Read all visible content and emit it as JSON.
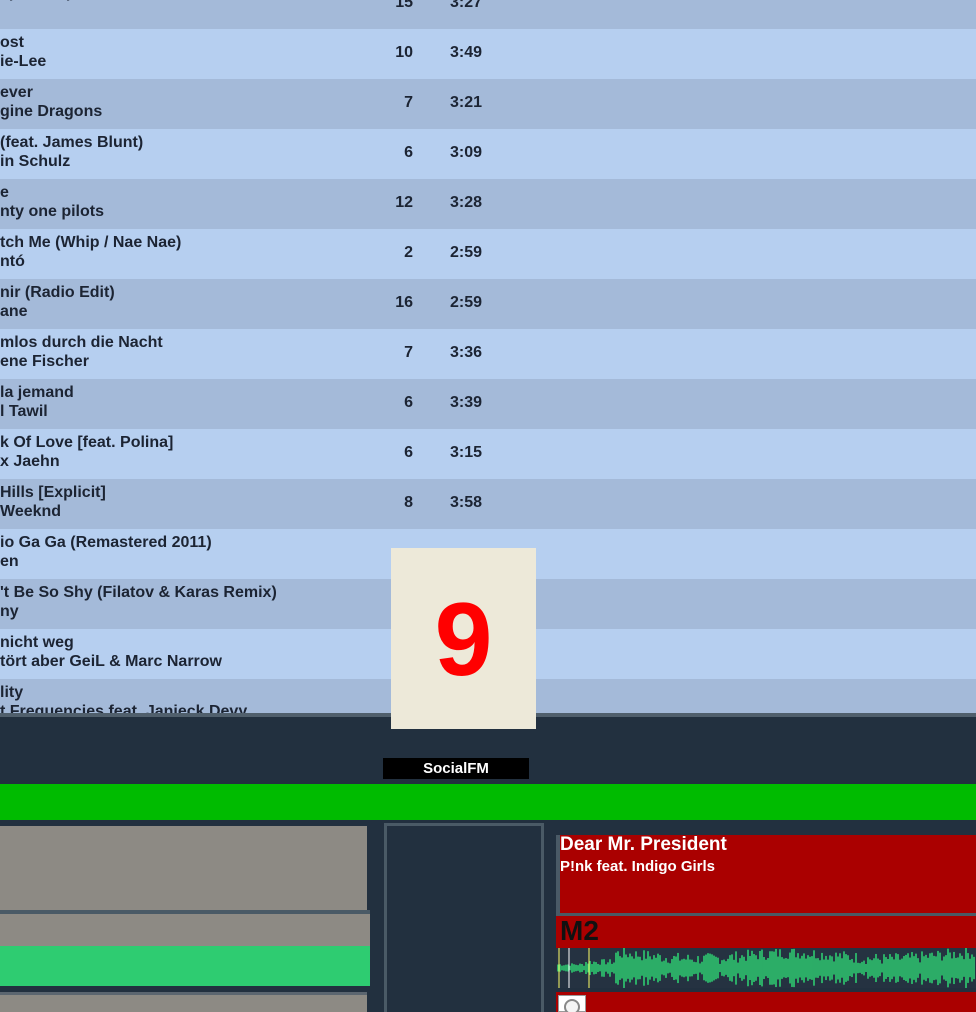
{
  "playlist": {
    "rows": [
      {
        "line1": "sperlenspiel",
        "line2": "",
        "num": "15",
        "dur": "3:27"
      },
      {
        "line1": "ost",
        "line2": "ie-Lee",
        "num": "10",
        "dur": "3:49"
      },
      {
        "line1": "ever",
        "line2": "gine Dragons",
        "num": "7",
        "dur": "3:21"
      },
      {
        "line1": "(feat. James Blunt)",
        "line2": "in Schulz",
        "num": "6",
        "dur": "3:09"
      },
      {
        "line1": "e",
        "line2": "nty one pilots",
        "num": "12",
        "dur": "3:28"
      },
      {
        "line1": "tch Me (Whip / Nae Nae)",
        "line2": "ntó",
        "num": "2",
        "dur": "2:59"
      },
      {
        "line1": "nir (Radio Edit)",
        "line2": "ane",
        "num": "16",
        "dur": "2:59"
      },
      {
        "line1": "mlos durch die Nacht",
        "line2": "ene Fischer",
        "num": "7",
        "dur": "3:36"
      },
      {
        "line1": "la jemand",
        "line2": "l Tawil",
        "num": "6",
        "dur": "3:39"
      },
      {
        "line1": "k Of Love [feat. Polina]",
        "line2": "x Jaehn",
        "num": "6",
        "dur": "3:15"
      },
      {
        "line1": " Hills [Explicit]",
        "line2": " Weeknd",
        "num": "8",
        "dur": "3:58"
      },
      {
        "line1": "io Ga Ga (Remastered 2011)",
        "line2": "en",
        "num": "",
        "dur": ""
      },
      {
        "line1": "'t Be So Shy (Filatov & Karas Remix)",
        "line2": "ny",
        "num": "",
        "dur": ""
      },
      {
        "line1": " nicht weg",
        "line2": "tört aber GeiL & Marc Narrow",
        "num": "",
        "dur": ""
      },
      {
        "line1": "lity",
        "line2": "t Frequencies feat. Janieck Devy",
        "num": "",
        "dur": ""
      }
    ]
  },
  "counter": {
    "value": "9"
  },
  "station": {
    "name": "SocialFM"
  },
  "player": {
    "title": "Dear Mr. President",
    "artist": "P!nk feat. Indigo Girls",
    "marker": "M2"
  },
  "colors": {
    "row_even": "#b6cff0",
    "row_odd": "#a4bad9",
    "green_bar": "#00bb00",
    "player_red": "#aa0000",
    "waveform": "#2ecc71",
    "counter_digit": "#ff0000"
  }
}
